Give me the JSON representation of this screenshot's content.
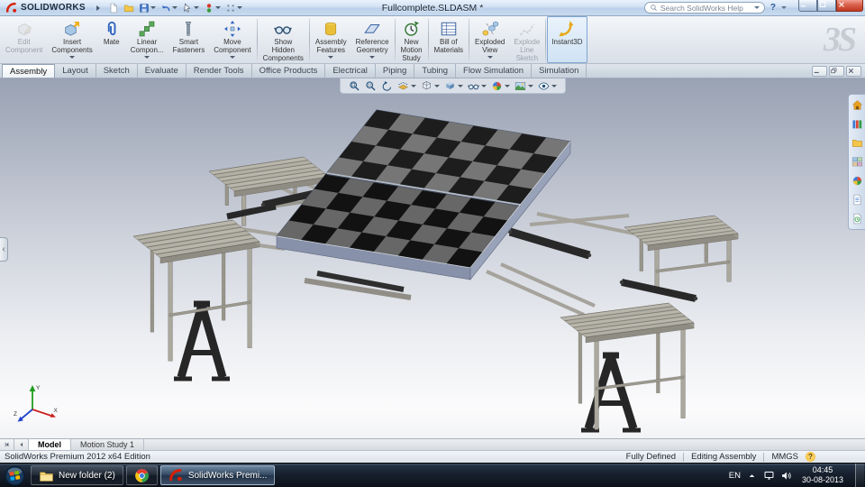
{
  "colors": {
    "titlebar_blue": "#bcd2ea",
    "ribbon_bg": "#e4e9ef",
    "viewport_top": "#99a2b3",
    "viewport_bottom": "#f7f8fa",
    "accent_red": "#d81e05",
    "checker_dark": "#161616",
    "checker_light": "#6e6e6e",
    "table_side_blue_gray": "#8791a9",
    "bench_slat": "#b6b3a9",
    "frame_dark": "#262626",
    "taskbar_active_glass": "#9cc3e8"
  },
  "title_bar": {
    "app_name": "SOLIDWORKS",
    "title": "Fullcomplete.SLDASM *",
    "search_placeholder": "Search SolidWorks Help",
    "help_label": "?",
    "quick_access": [
      {
        "name": "menu-expand-caret",
        "caret": false
      },
      {
        "name": "new-document",
        "caret": false
      },
      {
        "name": "open-folder",
        "caret": false
      },
      {
        "name": "save",
        "caret": true
      },
      {
        "name": "undo",
        "caret": true
      },
      {
        "name": "select-cursor",
        "caret": true
      },
      {
        "name": "rebuild",
        "caret": true
      },
      {
        "name": "options-grid",
        "caret": true
      }
    ]
  },
  "ribbon": {
    "watermark": "3S",
    "buttons": [
      {
        "label": "Edit\nComponent",
        "icon": "edit-component",
        "disabled": true
      },
      {
        "label": "Insert\nComponents",
        "icon": "insert-components",
        "caret": true
      },
      {
        "label": "Mate",
        "icon": "mate"
      },
      {
        "label": "Linear\nCompon...",
        "icon": "linear-pattern",
        "caret": true
      },
      {
        "label": "Smart\nFasteners",
        "icon": "smart-fasteners"
      },
      {
        "label": "Move\nComponent",
        "icon": "move-component",
        "caret": true,
        "sep_after": true
      },
      {
        "label": "Show\nHidden\nComponents",
        "icon": "show-hidden-components",
        "sep_after": true
      },
      {
        "label": "Assembly\nFeatures",
        "icon": "assembly-features",
        "caret": true
      },
      {
        "label": "Reference\nGeometry",
        "icon": "reference-geometry",
        "caret": true,
        "sep_after": true
      },
      {
        "label": "New\nMotion\nStudy",
        "icon": "new-motion-study",
        "sep_after": true
      },
      {
        "label": "Bill of\nMaterials",
        "icon": "bill-of-materials",
        "sep_after": true
      },
      {
        "label": "Exploded\nView",
        "icon": "exploded-view",
        "caret": true
      },
      {
        "label": "Explode\nLine\nSketch",
        "icon": "explode-line-sketch",
        "disabled": true,
        "sep_after": true
      },
      {
        "label": "Instant3D",
        "icon": "instant3d",
        "active": true
      }
    ]
  },
  "command_tabs": {
    "items": [
      {
        "label": "Assembly",
        "active": true
      },
      {
        "label": "Layout"
      },
      {
        "label": "Sketch"
      },
      {
        "label": "Evaluate"
      },
      {
        "label": "Render Tools"
      },
      {
        "label": "Office Products"
      },
      {
        "label": "Electrical"
      },
      {
        "label": "Piping"
      },
      {
        "label": "Tubing"
      },
      {
        "label": "Flow Simulation"
      },
      {
        "label": "Simulation"
      }
    ]
  },
  "view_toolbar": {
    "items": [
      {
        "name": "zoom-fit"
      },
      {
        "name": "zoom-area"
      },
      {
        "name": "previous-view"
      },
      {
        "name": "section-view",
        "caret": true
      },
      {
        "name": "view-orientation",
        "caret": true
      },
      {
        "name": "display-style",
        "caret": true
      },
      {
        "name": "hide-show-items",
        "caret": true
      },
      {
        "name": "edit-appearance",
        "caret": true
      },
      {
        "name": "apply-scene",
        "caret": true
      },
      {
        "name": "view-settings",
        "caret": true
      }
    ]
  },
  "task_pane": {
    "items": [
      {
        "name": "solidworks-resources"
      },
      {
        "name": "design-library"
      },
      {
        "name": "file-explorer"
      },
      {
        "name": "view-palette"
      },
      {
        "name": "appearances-scenes"
      },
      {
        "name": "custom-properties"
      },
      {
        "name": "document-recovery"
      }
    ]
  },
  "viewport": {
    "triad": {
      "x": "X",
      "y": "Y",
      "z": "Z"
    }
  },
  "model_tabs": {
    "items": [
      {
        "label": "Model",
        "active": true
      },
      {
        "label": "Motion Study 1"
      }
    ]
  },
  "status_bar": {
    "left": "SolidWorks Premium 2012 x64 Edition",
    "items": [
      "Fully Defined",
      "Editing Assembly",
      "MMGS"
    ],
    "help_label": "?"
  },
  "taskbar": {
    "buttons": [
      {
        "label": "New folder (2)",
        "icon": "folder"
      },
      {
        "icon": "chrome"
      },
      {
        "label": "SolidWorks Premi...",
        "icon": "solidworks",
        "active": true
      }
    ],
    "tray": {
      "language": "EN",
      "time": "04:45",
      "date": "30-08-2013"
    }
  }
}
